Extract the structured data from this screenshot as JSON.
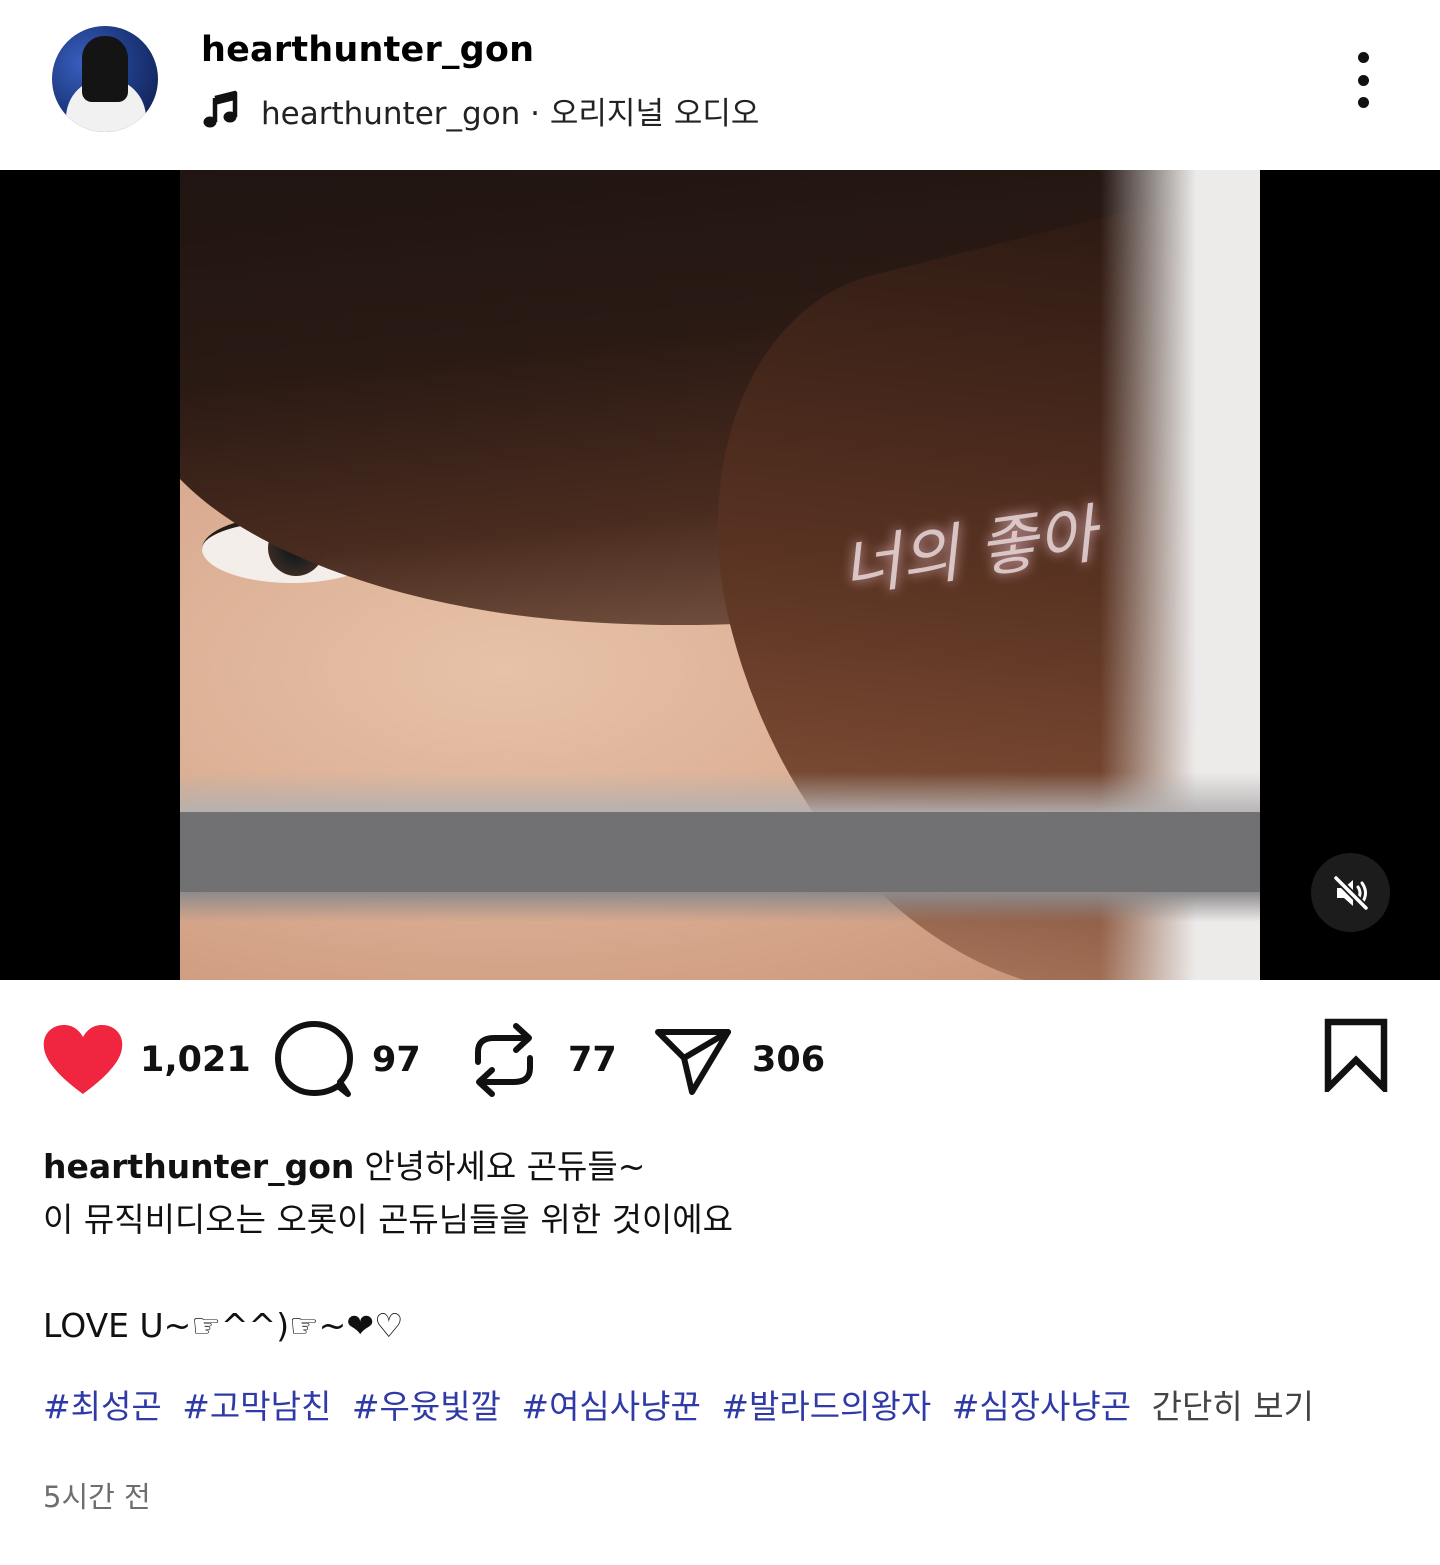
{
  "post": {
    "username": "hearthunter_gon",
    "audio": "hearthunter_gon · 오리지널 오디오",
    "video": {
      "overlay_text": "너의 좋아",
      "muted": true
    },
    "stats": {
      "likes": "1,021",
      "comments": "97",
      "reposts": "77",
      "shares": "306"
    },
    "caption": {
      "username": "hearthunter_gon",
      "line1": "안녕하세요 곤듀들~",
      "line2": "이 뮤직비디오는 오롯이 곤듀님들을 위한 것이에요",
      "line3": "LOVE U~☞^^)☞~❤♡"
    },
    "hashtags": [
      "#최성곤",
      "#고막남친",
      "#우윳빛깔",
      "#여심사냥꾼",
      "#발라드의왕자",
      "#심장사냥곤"
    ],
    "collapse_label": "간단히 보기",
    "timestamp": "5시간 전"
  },
  "colors": {
    "like": "#f0253f",
    "hashtag": "#2f3aa6",
    "muted_text": "#6e6e6e"
  },
  "icons": {
    "music": "music-note-icon",
    "more": "more-vertical-icon",
    "mute": "speaker-muted-icon",
    "like": "heart-filled-icon",
    "comment": "speech-bubble-icon",
    "repost": "repost-arrows-icon",
    "share": "paper-plane-icon",
    "bookmark": "bookmark-icon"
  }
}
